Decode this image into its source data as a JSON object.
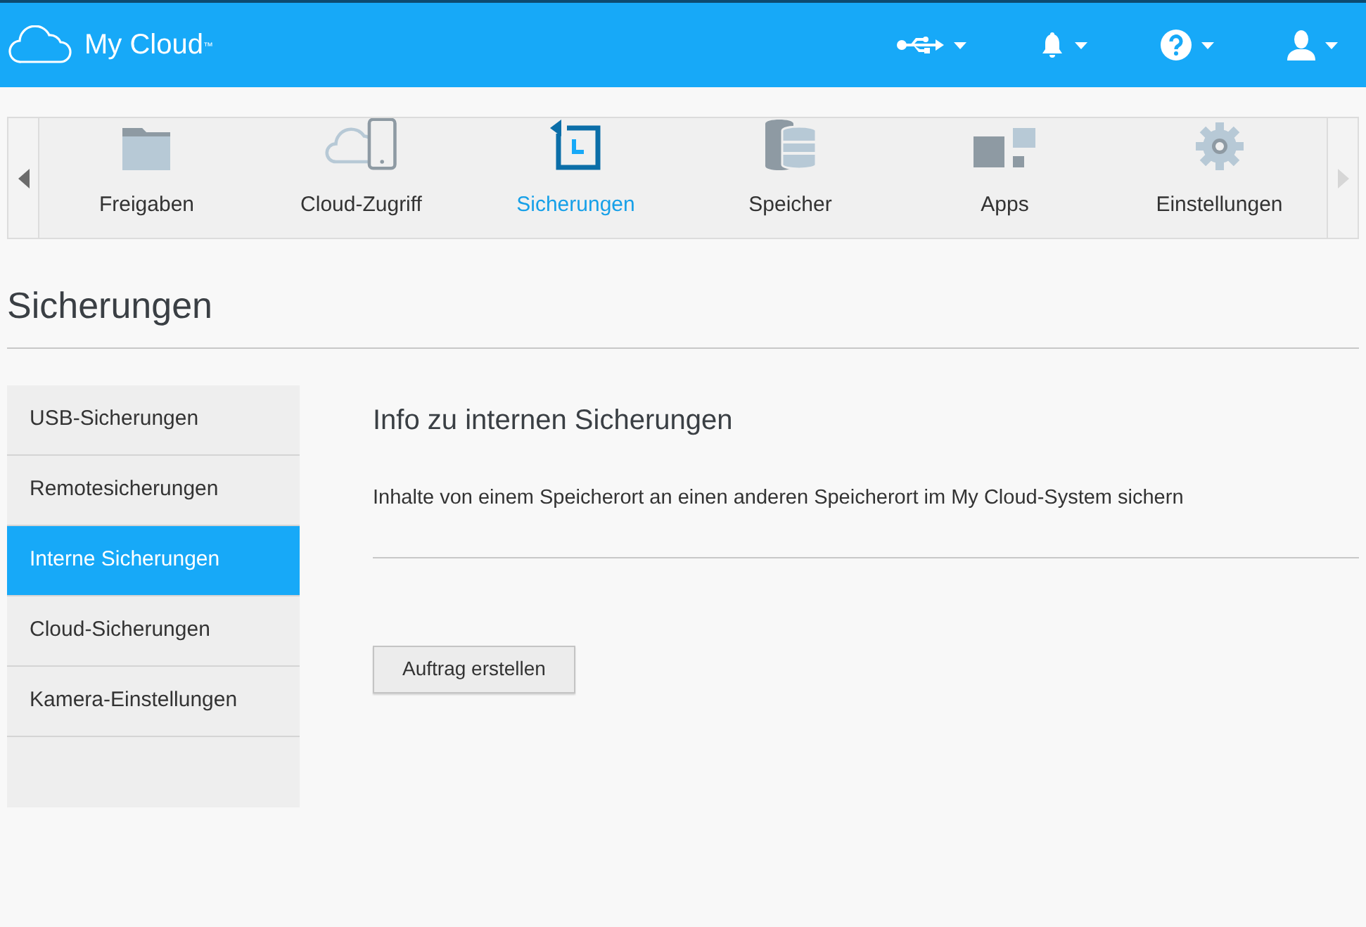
{
  "header": {
    "brand": "My Cloud$^{™}$",
    "icons": [
      {
        "kind": "usb"
      },
      {
        "kind": "bell"
      },
      {
        "kind": "help"
      },
      {
        "kind": "user"
      }
    ]
  },
  "nav": {
    "arrows": [
      {
        "kind": "left",
        "disabled": false
      },
      {
        "kind": "right",
        "disabled": true
      }
    ],
    "items": [
      {
        "label": "Freigaben",
        "kind": "folder",
        "selected": false
      },
      {
        "label": "Cloud-Zugriff",
        "kind": "cloud",
        "selected": false
      },
      {
        "label": "Sicherungen",
        "kind": "backup",
        "selected": true
      },
      {
        "label": "Speicher",
        "kind": "storage",
        "selected": false
      },
      {
        "label": "Apps",
        "kind": "apps",
        "selected": false
      },
      {
        "label": "Einstellungen",
        "kind": "settings",
        "selected": false
      }
    ]
  },
  "page_title": "Sicherungen",
  "sidebar": {
    "items": [
      {
        "label": "USB-Sicherungen",
        "selected": false
      },
      {
        "label": "Remotesicherungen",
        "selected": false
      },
      {
        "label": "Interne Sicherungen",
        "selected": true
      },
      {
        "label": "Cloud-Sicherungen",
        "selected": false
      },
      {
        "label": "Kamera-Einstellungen",
        "selected": false
      }
    ]
  },
  "content": {
    "heading": "Info zu internen Sicherungen",
    "description": "Inhalte von einem Speicherort an einen anderen Speicherort im My Cloud-System sichern",
    "button": "Auftrag erstellen"
  }
}
